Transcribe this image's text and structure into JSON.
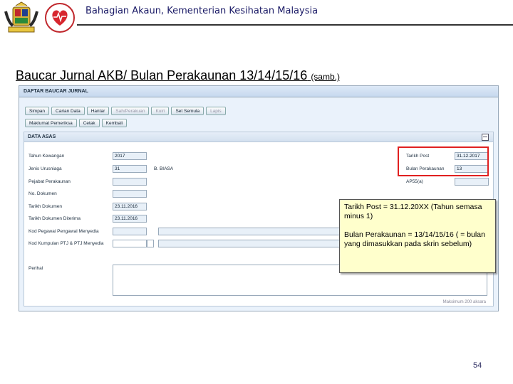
{
  "header": {
    "title": "Bahagian Akaun, Kementerian Kesihatan Malaysia"
  },
  "slide": {
    "title": "Baucar Jurnal AKB/ Bulan Perakaunan 13/14/15/16",
    "suffix": "(samb.)",
    "page_number": "54"
  },
  "app": {
    "window_title": "DAFTAR BAUCAR JURNAL",
    "buttons_row1": [
      "Simpan",
      "Carian Data",
      "Hantar",
      "Sah/Perakuan",
      "Kuiri",
      "Set Semula",
      "Lapis"
    ],
    "buttons_row2": [
      "Maklumat Pemeriksa",
      "Cetak",
      "Kembali"
    ],
    "section_title": "DATA ASAS",
    "fields": {
      "tahun_kewangan": {
        "label": "Tahun Kewangan",
        "value": "2017"
      },
      "jenis_urusniaga": {
        "label": "Jenis Urusniaga",
        "value": "31",
        "desc": "B. BIASA"
      },
      "pejabat_perakaunan": {
        "label": "Pejabat Perakaunan",
        "value": ""
      },
      "no_dokumen": {
        "label": "No. Dokumen",
        "value": ""
      },
      "tarikh_dokumen": {
        "label": "Tarikh Dokumen",
        "value": "23.11.2016"
      },
      "tarikh_dokumen_diterima": {
        "label": "Tarikh Dokumen Diterima",
        "value": "23.11.2016"
      },
      "kod_pegawai": {
        "label": "Kod Pegawai Pengawal Menyedia",
        "value": ""
      },
      "kod_kumpulan": {
        "label": "Kod Kumpulan PTJ & PTJ Menyedia",
        "value": ""
      },
      "perihal": {
        "label": "Perihal",
        "value": ""
      },
      "tarikh_post": {
        "label": "Tarikh Post",
        "value": "31.12.2017"
      },
      "bulan_perakaunan": {
        "label": "Bulan Perakaunan",
        "value": "13"
      },
      "ap55": {
        "label": "AP55(a)",
        "value": ""
      }
    },
    "counter_text": "Maksimum 200 aksara"
  },
  "callout": {
    "line1": "Tarikh Post = 31.12.20XX (Tahun semasa minus 1)",
    "line2": "Bulan Perakaunan = 13/14/15/16 ( = bulan yang dimasukkan pada skrin sebelum)"
  },
  "colors": {
    "highlight_box": "#e02020",
    "callout_bg": "#ffffcc",
    "header_text": "#1a1a66"
  }
}
